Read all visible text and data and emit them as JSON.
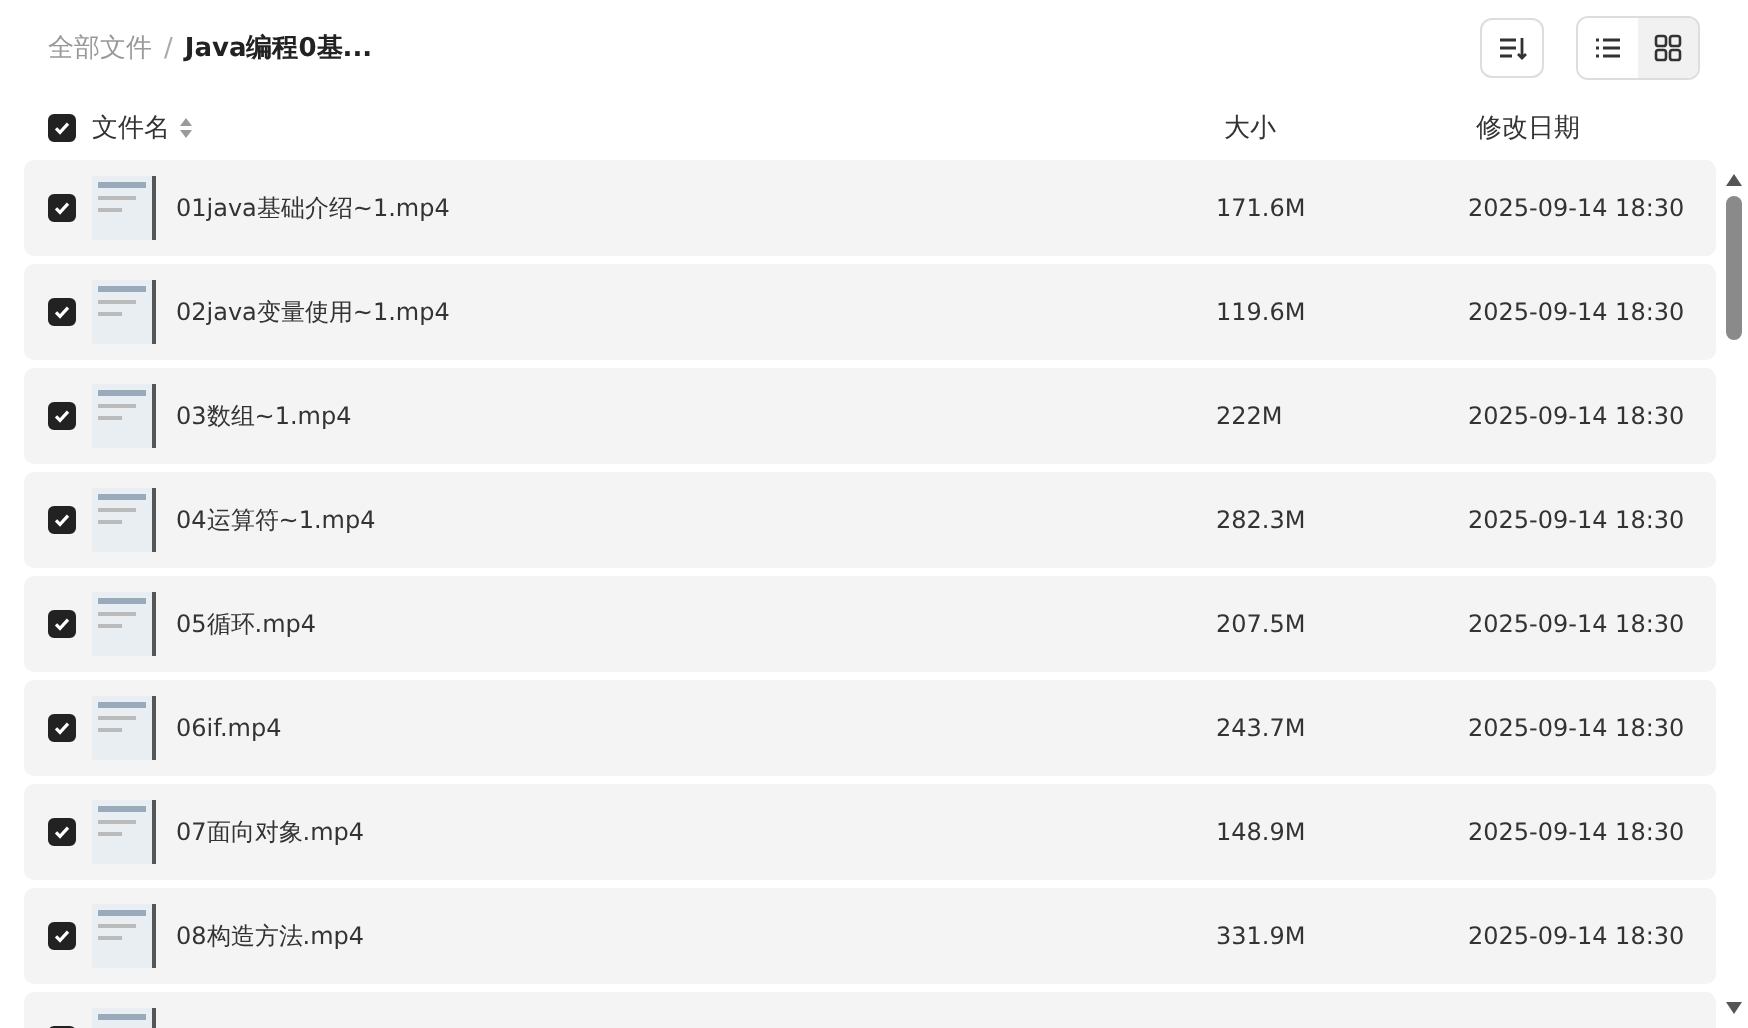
{
  "breadcrumb_separator": "/",
  "breadcrumb": [
    {
      "label": "全部文件",
      "current": false
    },
    {
      "label": "Java编程0基...",
      "current": true
    }
  ],
  "view_toggle": [
    {
      "kind": "list",
      "selected": true
    },
    {
      "kind": "grid",
      "selected": false
    }
  ],
  "table": {
    "select_all": {
      "checked": true
    },
    "columns": [
      {
        "label": "文件名",
        "sortable": true
      },
      {
        "label": "大小",
        "sortable": false
      },
      {
        "label": "修改日期",
        "sortable": false
      }
    ],
    "rows": [
      {
        "checked": true,
        "name": "01java基础介绍~1.mp4",
        "size": "171.6M",
        "modified": "2025-09-14 18:30"
      },
      {
        "checked": true,
        "name": "02java变量使用~1.mp4",
        "size": "119.6M",
        "modified": "2025-09-14 18:30"
      },
      {
        "checked": true,
        "name": "03数组~1.mp4",
        "size": "222M",
        "modified": "2025-09-14 18:30"
      },
      {
        "checked": true,
        "name": "04运算符~1.mp4",
        "size": "282.3M",
        "modified": "2025-09-14 18:30"
      },
      {
        "checked": true,
        "name": "05循环.mp4",
        "size": "207.5M",
        "modified": "2025-09-14 18:30"
      },
      {
        "checked": true,
        "name": "06if.mp4",
        "size": "243.7M",
        "modified": "2025-09-14 18:30"
      },
      {
        "checked": true,
        "name": "07面向对象.mp4",
        "size": "148.9M",
        "modified": "2025-09-14 18:30"
      },
      {
        "checked": true,
        "name": "08构造方法.mp4",
        "size": "331.9M",
        "modified": "2025-09-14 18:30"
      },
      {
        "checked": true
      }
    ]
  }
}
